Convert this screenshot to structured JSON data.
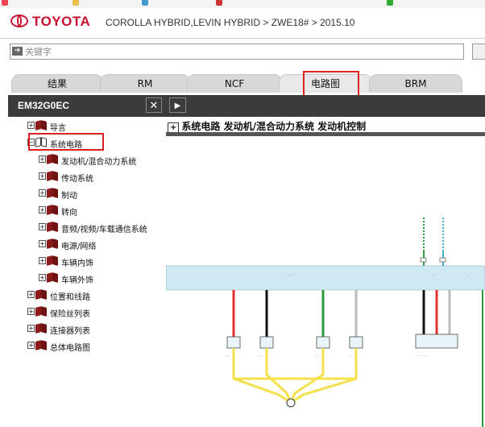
{
  "header": {
    "logo_text": "TOYOTA",
    "breadcrumb": "COROLLA HYBRID,LEVIN HYBRID > ZWE18# > 2015.10"
  },
  "search": {
    "placeholder": "关键字"
  },
  "tabs": [
    {
      "label": "结果"
    },
    {
      "label": "RM"
    },
    {
      "label": "NCF"
    },
    {
      "label": "电路图",
      "active": true
    },
    {
      "label": "BRM"
    }
  ],
  "left_panel": {
    "title": "EM32G0EC",
    "close_label": "✕"
  },
  "tree": [
    {
      "label": "导言",
      "level": 1
    },
    {
      "label": "系统电路",
      "level": 1,
      "expanded": true
    },
    {
      "label": "发动机/混合动力系统",
      "level": 2
    },
    {
      "label": "传动系统",
      "level": 2
    },
    {
      "label": "制动",
      "level": 2
    },
    {
      "label": "转向",
      "level": 2
    },
    {
      "label": "音频/视频/车载通信系统",
      "level": 2
    },
    {
      "label": "电源/网络",
      "level": 2
    },
    {
      "label": "车辆内饰",
      "level": 2
    },
    {
      "label": "车辆外饰",
      "level": 2
    },
    {
      "label": "位置和线路",
      "level": 1
    },
    {
      "label": "保险丝列表",
      "level": 1
    },
    {
      "label": "连接器列表",
      "level": 1
    },
    {
      "label": "总体电路图",
      "level": 1
    }
  ],
  "diagram": {
    "title": "系统电路 发动机/混合动力系统 发动机控制",
    "title_prefix": "+",
    "colors": {
      "bar": "#cfe9f3",
      "wire_red": "#e53030",
      "wire_black": "#111111",
      "wire_green": "#2c9a3c",
      "wire_yellow": "#f4e04a",
      "wire_white": "#bbbbbb",
      "wire_teal": "#3fb0c9"
    }
  },
  "colors": {
    "brand": "#c8102e",
    "highlight": "#e02020",
    "panel_header": "#3b3b3b"
  }
}
